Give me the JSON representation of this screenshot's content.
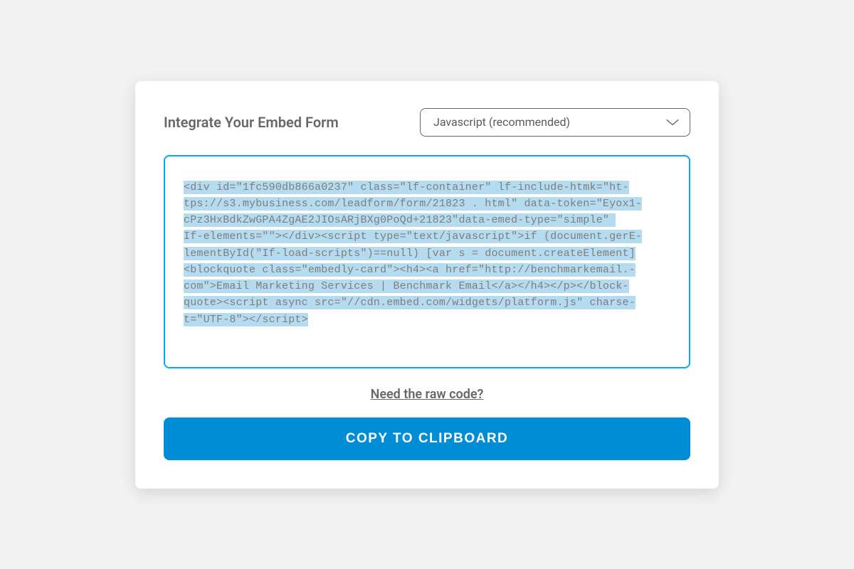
{
  "header": {
    "title": "Integrate Your Embed Form"
  },
  "select": {
    "value": "Javascript (recommended)"
  },
  "code": {
    "lines": [
      "<div id=\"1fc590db866a0237\" class=\"lf-container\" lf-include-htmk=\"ht-",
      "tps://s3.mybusiness.com/leadform/form/21823 . html\" data-token=\"Eyox1-",
      "cPz3HxBdkZwGPA4ZgAE2JIOsARjBXg0PoQd+21823\"data-emed-type=\"simple\" ",
      "If-elements=\"\"></div><script type=\"text/javascript\">if (document.gerE-",
      "lementById(\"If-load-scripts\")==null) [var s = document.createElement]",
      "<blockquote class=\"embedly-card\"><h4><a href=\"http://benchmarkemail.-",
      "com\">Email Marketing Services | Benchmark Email</a></h4></p></block-",
      "quote><script async src=\"//cdn.embed.com/widgets/platform.js\" charse-",
      "t=\"UTF-8\"></script>"
    ]
  },
  "links": {
    "raw_code": "Need the raw code?"
  },
  "buttons": {
    "copy": "COPY TO CLIPBOARD"
  }
}
